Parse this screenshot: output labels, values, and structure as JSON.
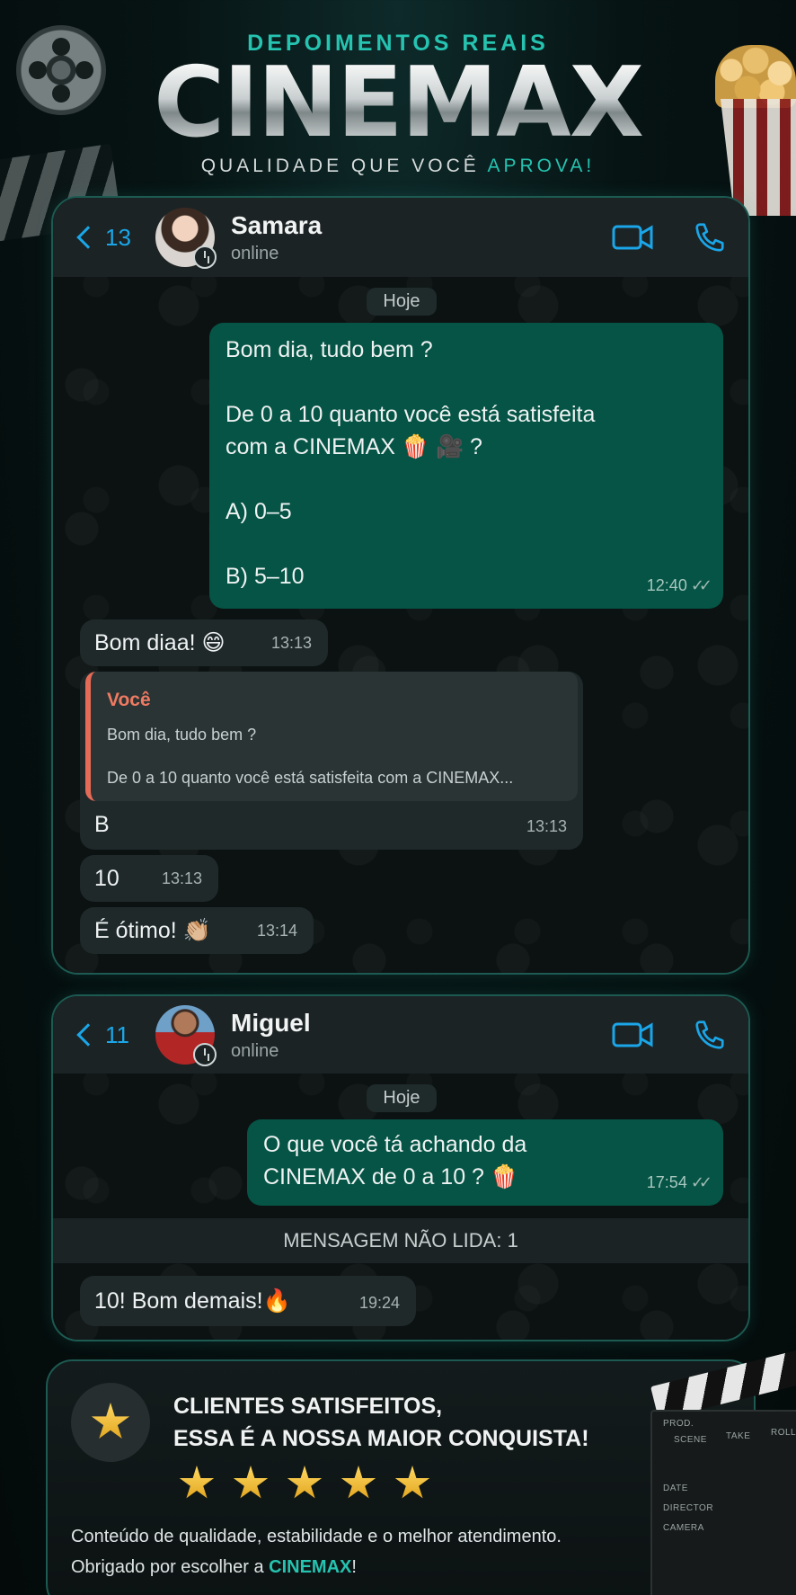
{
  "header": {
    "kicker": "DEPOIMENTOS REAIS",
    "brand": "CINEMAX",
    "tagline_prefix": "QUALIDADE QUE VOCÊ ",
    "tagline_highlight": "APROVA!"
  },
  "chat1": {
    "back_count": "13",
    "contact_name": "Samara",
    "contact_status": "online",
    "day_label": "Hoje",
    "outgoing": {
      "text": "Bom dia, tudo bem ?\n\nDe 0 a 10 quanto você está satisfeita\ncom a CINEMAX 🍿 🎥 ?\n\nA) 0–5\n\nB) 5–10",
      "time": "12:40"
    },
    "incoming": [
      {
        "text": "Bom diaa! 😄",
        "time": "13:13"
      },
      {
        "reply_author": "Você",
        "reply_text": "Bom dia, tudo bem ?\n\nDe 0 a 10 quanto você está satisfeita com a CINEMAX...",
        "text": "B",
        "time": "13:13"
      },
      {
        "text": "10",
        "time": "13:13"
      },
      {
        "text": "É ótimo! 👏🏼",
        "time": "13:14"
      }
    ]
  },
  "chat2": {
    "back_count": "11",
    "contact_name": "Miguel",
    "contact_status": "online",
    "day_label": "Hoje",
    "outgoing": {
      "text": "O que você tá achando da\nCINEMAX de 0 a 10 ? 🍿",
      "time": "17:54"
    },
    "unread_label": "MENSAGEM NÃO LIDA: 1",
    "incoming": [
      {
        "text": "10! Bom demais!🔥",
        "time": "19:24"
      }
    ]
  },
  "footer": {
    "cta_line1": "CLIENTES SATISFEITOS,",
    "cta_line2": "ESSA É A NOSSA MAIOR CONQUISTA!",
    "rating": 5,
    "rating_max": 5,
    "desc_line1": "Conteúdo de qualidade, estabilidade e o melhor atendimento.",
    "desc_line2_prefix": "Obrigado por escolher a ",
    "desc_line2_brand": "CINEMAX",
    "desc_line2_suffix": "!"
  },
  "clapperboard": {
    "prod": "PROD.",
    "scene": "SCENE",
    "take": "TAKE",
    "roll": "ROLL",
    "date": "DATE",
    "director": "DIRECTOR",
    "camera": "CAMERA"
  },
  "icons": {
    "back": "chevron-left-icon",
    "video": "video-camera-icon",
    "call": "phone-icon",
    "ticks": "double-check-icon",
    "star": "star-icon"
  },
  "colors": {
    "accent": "#25c3b0",
    "link": "#1aa6e8",
    "outgoing_bubble": "#055445",
    "incoming_bubble": "#20292a",
    "reply_author": "#ef7a62",
    "star": "#f2b62c"
  }
}
